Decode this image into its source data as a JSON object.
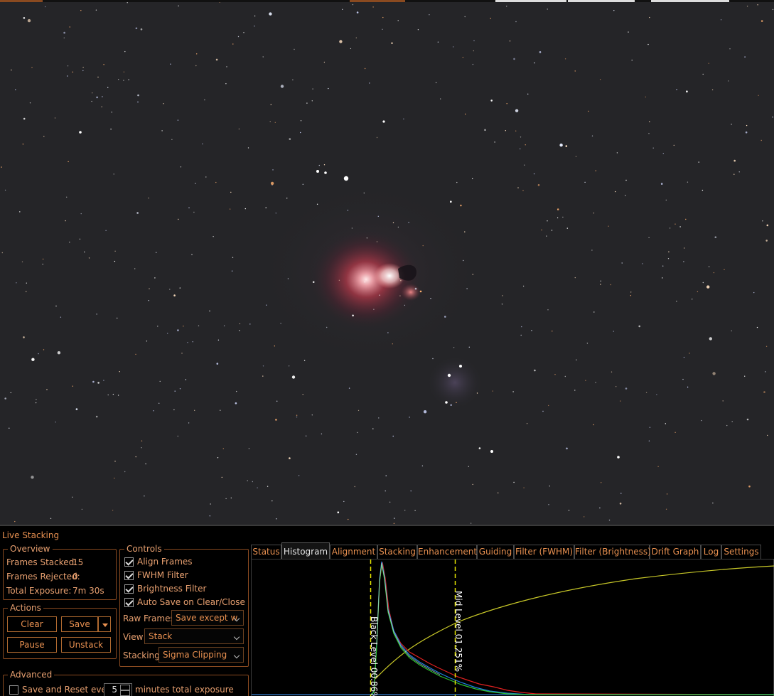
{
  "colors": {
    "accent": "#e89050",
    "sky_background": "#252528",
    "black_level_line": "#e6e600",
    "curve": "#c8c828",
    "hist_red": "#e02020",
    "hist_green": "#2ec030",
    "hist_blue": "#2080e0"
  },
  "panel": {
    "title": "Live Stacking",
    "overview": {
      "legend": "Overview",
      "frames_stacked_label": "Frames Stacked:",
      "frames_stacked_value": "15",
      "frames_rejected_label": "Frames Rejected:",
      "frames_rejected_value": "0",
      "total_exposure_label": "Total Exposure:",
      "total_exposure_value": "7m 30s"
    },
    "actions": {
      "legend": "Actions",
      "clear": "Clear",
      "save": "Save",
      "pause": "Pause",
      "unstack": "Unstack"
    },
    "advanced": {
      "legend": "Advanced",
      "save_reset_label": "Save and Reset every",
      "save_reset_value": "5",
      "save_reset_suffix": "minutes total exposure",
      "save_reset_checked": false
    },
    "controls": {
      "legend": "Controls",
      "align_frames": "Align Frames",
      "fwhm_filter": "FWHM Filter",
      "brightness_filter": "Brightness Filter",
      "auto_save": "Auto Save on Clear/Close",
      "raw_frames_label": "Raw Frames",
      "raw_frames_value": "Save except w",
      "view_label": "View",
      "view_value": "Stack",
      "stacking_label": "Stacking",
      "stacking_value": "Sigma Clipping"
    },
    "tabs": [
      "Status",
      "Histogram",
      "Alignment",
      "Stacking",
      "Enhancement",
      "Guiding",
      "Filter (FWHM)",
      "Filter (Brightness)",
      "Drift Graph",
      "Log",
      "Settings"
    ],
    "active_tab": "Histogram",
    "histogram": {
      "black_level_label": "Black Level  00.86%",
      "mid_level_label": "Mid Level  01.251%"
    }
  }
}
